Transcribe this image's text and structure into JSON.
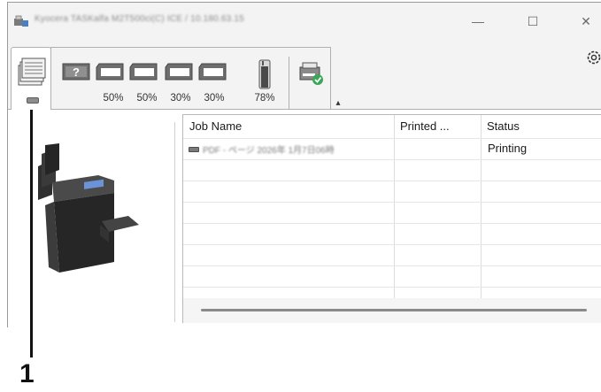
{
  "window": {
    "title": "Kyocera TASKalfa M2T500ci(C) ICE / 10.180.63.15",
    "minimize_glyph": "—",
    "maximize_glyph": "☐",
    "close_glyph": "✕"
  },
  "toolbar": {
    "trays": [
      {
        "name": "manual-feed-tray",
        "level": "?"
      },
      {
        "name": "tray-1",
        "percent": "50%"
      },
      {
        "name": "tray-2",
        "percent": "50%"
      },
      {
        "name": "tray-3",
        "percent": "30%"
      },
      {
        "name": "tray-4",
        "percent": "30%"
      }
    ],
    "toner_percent": "78%",
    "collapse_glyph": "▴",
    "settings_icon": "gear-icon"
  },
  "job_table": {
    "columns": [
      "Job Name",
      "Printed ...",
      "Status"
    ],
    "rows": [
      {
        "job_name": "PDF - ページ 2026年 1月7日06時",
        "printed": "",
        "status": "Printing"
      }
    ]
  },
  "callout": {
    "number": "1"
  },
  "colors": {
    "window_bg": "#f3f3f3",
    "content_bg": "#ffffff",
    "border": "#b0b0b0",
    "led": "#8c8c8c"
  }
}
